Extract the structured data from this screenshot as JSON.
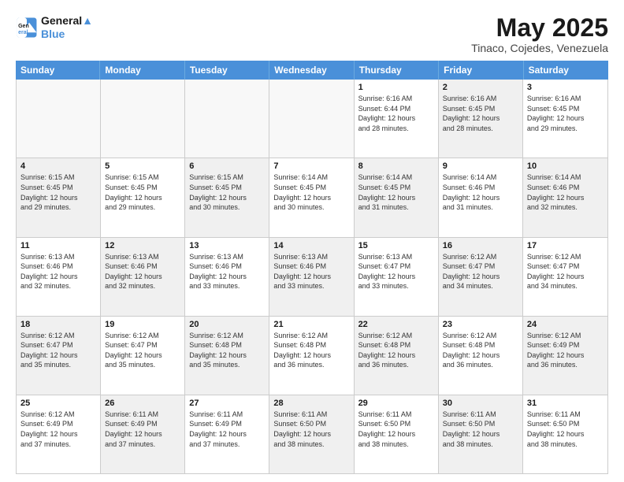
{
  "logo": {
    "line1": "General",
    "line2": "Blue"
  },
  "title": "May 2025",
  "subtitle": "Tinaco, Cojedes, Venezuela",
  "days": [
    "Sunday",
    "Monday",
    "Tuesday",
    "Wednesday",
    "Thursday",
    "Friday",
    "Saturday"
  ],
  "rows": [
    [
      {
        "day": "",
        "empty": true
      },
      {
        "day": "",
        "empty": true
      },
      {
        "day": "",
        "empty": true
      },
      {
        "day": "",
        "empty": true
      },
      {
        "day": "1",
        "line1": "Sunrise: 6:16 AM",
        "line2": "Sunset: 6:44 PM",
        "line3": "Daylight: 12 hours",
        "line4": "and 28 minutes.",
        "shaded": false
      },
      {
        "day": "2",
        "line1": "Sunrise: 6:16 AM",
        "line2": "Sunset: 6:45 PM",
        "line3": "Daylight: 12 hours",
        "line4": "and 28 minutes.",
        "shaded": true
      },
      {
        "day": "3",
        "line1": "Sunrise: 6:16 AM",
        "line2": "Sunset: 6:45 PM",
        "line3": "Daylight: 12 hours",
        "line4": "and 29 minutes.",
        "shaded": false
      }
    ],
    [
      {
        "day": "4",
        "line1": "Sunrise: 6:15 AM",
        "line2": "Sunset: 6:45 PM",
        "line3": "Daylight: 12 hours",
        "line4": "and 29 minutes.",
        "shaded": true
      },
      {
        "day": "5",
        "line1": "Sunrise: 6:15 AM",
        "line2": "Sunset: 6:45 PM",
        "line3": "Daylight: 12 hours",
        "line4": "and 29 minutes.",
        "shaded": false
      },
      {
        "day": "6",
        "line1": "Sunrise: 6:15 AM",
        "line2": "Sunset: 6:45 PM",
        "line3": "Daylight: 12 hours",
        "line4": "and 30 minutes.",
        "shaded": true
      },
      {
        "day": "7",
        "line1": "Sunrise: 6:14 AM",
        "line2": "Sunset: 6:45 PM",
        "line3": "Daylight: 12 hours",
        "line4": "and 30 minutes.",
        "shaded": false
      },
      {
        "day": "8",
        "line1": "Sunrise: 6:14 AM",
        "line2": "Sunset: 6:45 PM",
        "line3": "Daylight: 12 hours",
        "line4": "and 31 minutes.",
        "shaded": true
      },
      {
        "day": "9",
        "line1": "Sunrise: 6:14 AM",
        "line2": "Sunset: 6:46 PM",
        "line3": "Daylight: 12 hours",
        "line4": "and 31 minutes.",
        "shaded": false
      },
      {
        "day": "10",
        "line1": "Sunrise: 6:14 AM",
        "line2": "Sunset: 6:46 PM",
        "line3": "Daylight: 12 hours",
        "line4": "and 32 minutes.",
        "shaded": true
      }
    ],
    [
      {
        "day": "11",
        "line1": "Sunrise: 6:13 AM",
        "line2": "Sunset: 6:46 PM",
        "line3": "Daylight: 12 hours",
        "line4": "and 32 minutes.",
        "shaded": false
      },
      {
        "day": "12",
        "line1": "Sunrise: 6:13 AM",
        "line2": "Sunset: 6:46 PM",
        "line3": "Daylight: 12 hours",
        "line4": "and 32 minutes.",
        "shaded": true
      },
      {
        "day": "13",
        "line1": "Sunrise: 6:13 AM",
        "line2": "Sunset: 6:46 PM",
        "line3": "Daylight: 12 hours",
        "line4": "and 33 minutes.",
        "shaded": false
      },
      {
        "day": "14",
        "line1": "Sunrise: 6:13 AM",
        "line2": "Sunset: 6:46 PM",
        "line3": "Daylight: 12 hours",
        "line4": "and 33 minutes.",
        "shaded": true
      },
      {
        "day": "15",
        "line1": "Sunrise: 6:13 AM",
        "line2": "Sunset: 6:47 PM",
        "line3": "Daylight: 12 hours",
        "line4": "and 33 minutes.",
        "shaded": false
      },
      {
        "day": "16",
        "line1": "Sunrise: 6:12 AM",
        "line2": "Sunset: 6:47 PM",
        "line3": "Daylight: 12 hours",
        "line4": "and 34 minutes.",
        "shaded": true
      },
      {
        "day": "17",
        "line1": "Sunrise: 6:12 AM",
        "line2": "Sunset: 6:47 PM",
        "line3": "Daylight: 12 hours",
        "line4": "and 34 minutes.",
        "shaded": false
      }
    ],
    [
      {
        "day": "18",
        "line1": "Sunrise: 6:12 AM",
        "line2": "Sunset: 6:47 PM",
        "line3": "Daylight: 12 hours",
        "line4": "and 35 minutes.",
        "shaded": true
      },
      {
        "day": "19",
        "line1": "Sunrise: 6:12 AM",
        "line2": "Sunset: 6:47 PM",
        "line3": "Daylight: 12 hours",
        "line4": "and 35 minutes.",
        "shaded": false
      },
      {
        "day": "20",
        "line1": "Sunrise: 6:12 AM",
        "line2": "Sunset: 6:48 PM",
        "line3": "Daylight: 12 hours",
        "line4": "and 35 minutes.",
        "shaded": true
      },
      {
        "day": "21",
        "line1": "Sunrise: 6:12 AM",
        "line2": "Sunset: 6:48 PM",
        "line3": "Daylight: 12 hours",
        "line4": "and 36 minutes.",
        "shaded": false
      },
      {
        "day": "22",
        "line1": "Sunrise: 6:12 AM",
        "line2": "Sunset: 6:48 PM",
        "line3": "Daylight: 12 hours",
        "line4": "and 36 minutes.",
        "shaded": true
      },
      {
        "day": "23",
        "line1": "Sunrise: 6:12 AM",
        "line2": "Sunset: 6:48 PM",
        "line3": "Daylight: 12 hours",
        "line4": "and 36 minutes.",
        "shaded": false
      },
      {
        "day": "24",
        "line1": "Sunrise: 6:12 AM",
        "line2": "Sunset: 6:49 PM",
        "line3": "Daylight: 12 hours",
        "line4": "and 36 minutes.",
        "shaded": true
      }
    ],
    [
      {
        "day": "25",
        "line1": "Sunrise: 6:12 AM",
        "line2": "Sunset: 6:49 PM",
        "line3": "Daylight: 12 hours",
        "line4": "and 37 minutes.",
        "shaded": false
      },
      {
        "day": "26",
        "line1": "Sunrise: 6:11 AM",
        "line2": "Sunset: 6:49 PM",
        "line3": "Daylight: 12 hours",
        "line4": "and 37 minutes.",
        "shaded": true
      },
      {
        "day": "27",
        "line1": "Sunrise: 6:11 AM",
        "line2": "Sunset: 6:49 PM",
        "line3": "Daylight: 12 hours",
        "line4": "and 37 minutes.",
        "shaded": false
      },
      {
        "day": "28",
        "line1": "Sunrise: 6:11 AM",
        "line2": "Sunset: 6:50 PM",
        "line3": "Daylight: 12 hours",
        "line4": "and 38 minutes.",
        "shaded": true
      },
      {
        "day": "29",
        "line1": "Sunrise: 6:11 AM",
        "line2": "Sunset: 6:50 PM",
        "line3": "Daylight: 12 hours",
        "line4": "and 38 minutes.",
        "shaded": false
      },
      {
        "day": "30",
        "line1": "Sunrise: 6:11 AM",
        "line2": "Sunset: 6:50 PM",
        "line3": "Daylight: 12 hours",
        "line4": "and 38 minutes.",
        "shaded": true
      },
      {
        "day": "31",
        "line1": "Sunrise: 6:11 AM",
        "line2": "Sunset: 6:50 PM",
        "line3": "Daylight: 12 hours",
        "line4": "and 38 minutes.",
        "shaded": false
      }
    ]
  ]
}
